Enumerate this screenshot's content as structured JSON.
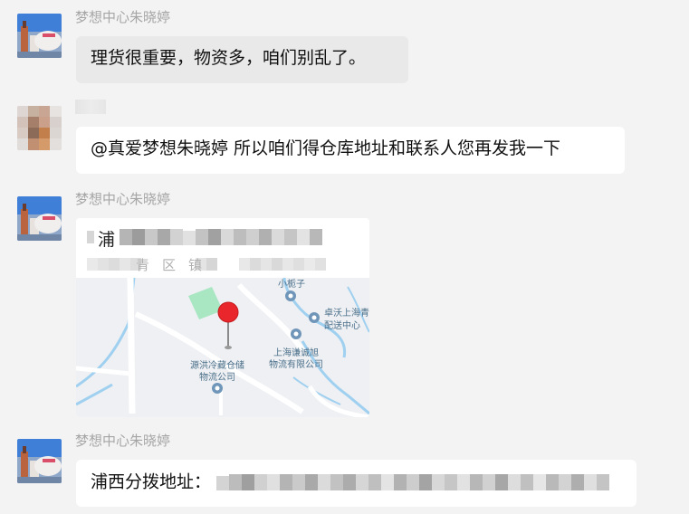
{
  "messages": [
    {
      "sender": "梦想中心朱晓婷",
      "text": "理货很重要，物资多，咱们别乱了。"
    },
    {
      "sender": "",
      "text": "@真爱梦想朱晓婷 所以咱们得仓库地址和联系人您再发我一下"
    },
    {
      "sender": "梦想中心朱晓婷",
      "location": {
        "title": "浦",
        "address": "青区镇",
        "map_labels": [
          "小栀子",
          "卓沃上海青",
          "配送中心",
          "上海谦诚旭",
          "物流有限公司",
          "源洪冷藏仓储",
          "物流公司"
        ]
      }
    },
    {
      "sender": "梦想中心朱晓婷",
      "text": "浦西分拨地址："
    }
  ],
  "colors": {
    "pin": "#e8262b",
    "map_bg": "#eef0f3",
    "road": "#ffffff",
    "water": "#9fd0f0",
    "park": "#a9e6c2",
    "label": "#4a6f8a"
  }
}
